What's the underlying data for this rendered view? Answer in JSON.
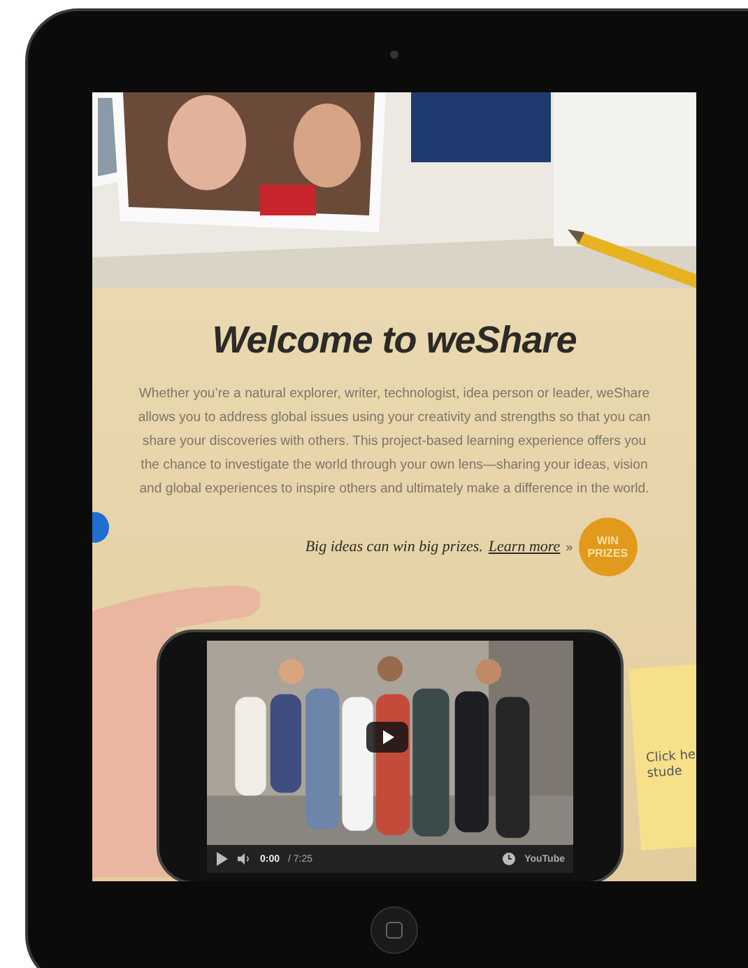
{
  "heading": "Welcome to weShare",
  "intro": "Whether you’re a natural explorer, writer, technologist, idea person or leader, weShare allows you to address global issues using your creativity and strengths so that you can share your discoveries with others. This project-based learning experience offers you the chance to investigate the world through your own lens—sharing your ideas, vision and global experiences to inspire others and ultimately make a difference in the world.",
  "tagline": "Big ideas can win big prizes.",
  "link": "Learn more",
  "link_arrow": "»",
  "badge": "WIN PRIZES",
  "video": {
    "kind": "picture",
    "time_current": "0:00",
    "time_total": "/ 7:25",
    "logo": "YouTube"
  },
  "note": {
    "lines": [
      "Click he",
      "stude"
    ]
  }
}
